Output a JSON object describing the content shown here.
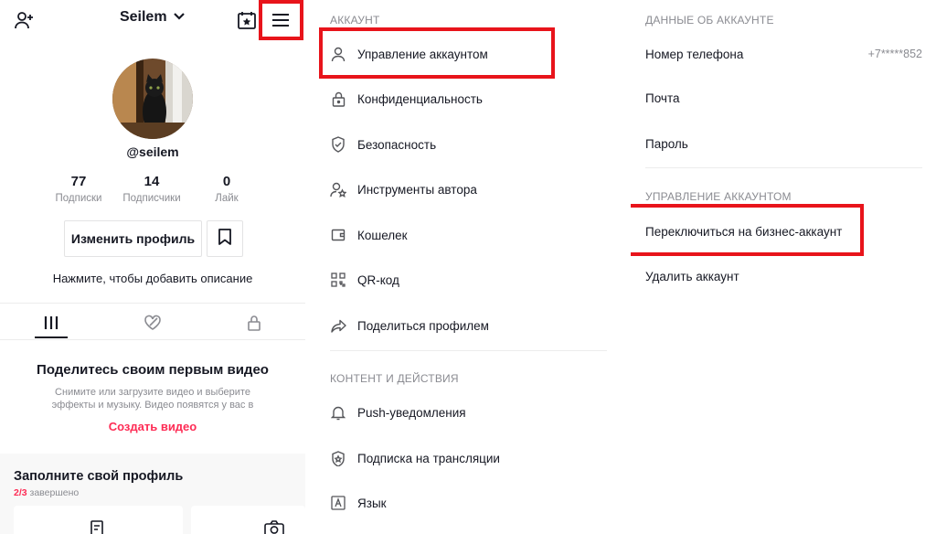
{
  "profile": {
    "username": "Seilem",
    "handle": "@seilem",
    "stats": [
      {
        "value": "77",
        "label": "Подписки"
      },
      {
        "value": "14",
        "label": "Подписчики"
      },
      {
        "value": "0",
        "label": "Лайк"
      }
    ],
    "edit_button": "Изменить профиль",
    "bio_hint": "Нажмите, чтобы добавить описание",
    "empty_title": "Поделитесь своим первым видео",
    "empty_subtitle": "Снимите или загрузите видео и выберите эффекты и музыку. Видео появятся у вас в",
    "create_link": "Создать видео",
    "complete_title": "Заполните свой профиль",
    "complete_progress": "2/3",
    "complete_progress_suffix": " завершено",
    "icons": [
      "add-user-icon",
      "chevron-down-icon",
      "calendar-icon",
      "menu-icon",
      "bookmark-icon",
      "grid-icon",
      "liked-icon",
      "lock-icon"
    ]
  },
  "settings": {
    "account_section": "АККАУНТ",
    "account_items": [
      {
        "label": "Управление аккаунтом",
        "icon": "person-icon"
      },
      {
        "label": "Конфиденциальность",
        "icon": "lock-icon"
      },
      {
        "label": "Безопасность",
        "icon": "shield-icon"
      },
      {
        "label": "Инструменты автора",
        "icon": "creator-tools-icon"
      },
      {
        "label": "Кошелек",
        "icon": "wallet-icon"
      },
      {
        "label": "QR-код",
        "icon": "qr-code-icon"
      },
      {
        "label": "Поделиться профилем",
        "icon": "share-icon"
      }
    ],
    "content_section": "КОНТЕНТ И ДЕЙСТВИЯ",
    "content_items": [
      {
        "label": "Push-уведомления",
        "icon": "bell-icon"
      },
      {
        "label": "Подписка на трансляции",
        "icon": "live-subscription-icon"
      },
      {
        "label": "Язык",
        "icon": "language-icon"
      }
    ]
  },
  "account_details": {
    "info_section": "ДАННЫЕ ОБ АККАУНТЕ",
    "phone_label": "Номер телефона",
    "phone_value": "+7*****852",
    "email_label": "Почта",
    "password_label": "Пароль",
    "manage_section": "УПРАВЛЕНИЕ АККАУНТОМ",
    "switch_business": "Переключиться на бизнес-аккаунт",
    "delete_account": "Удалить аккаунт"
  },
  "colors": {
    "highlight_border": "#e8141b",
    "accent": "#fe2c55",
    "secondary_text": "#8a8b91"
  }
}
